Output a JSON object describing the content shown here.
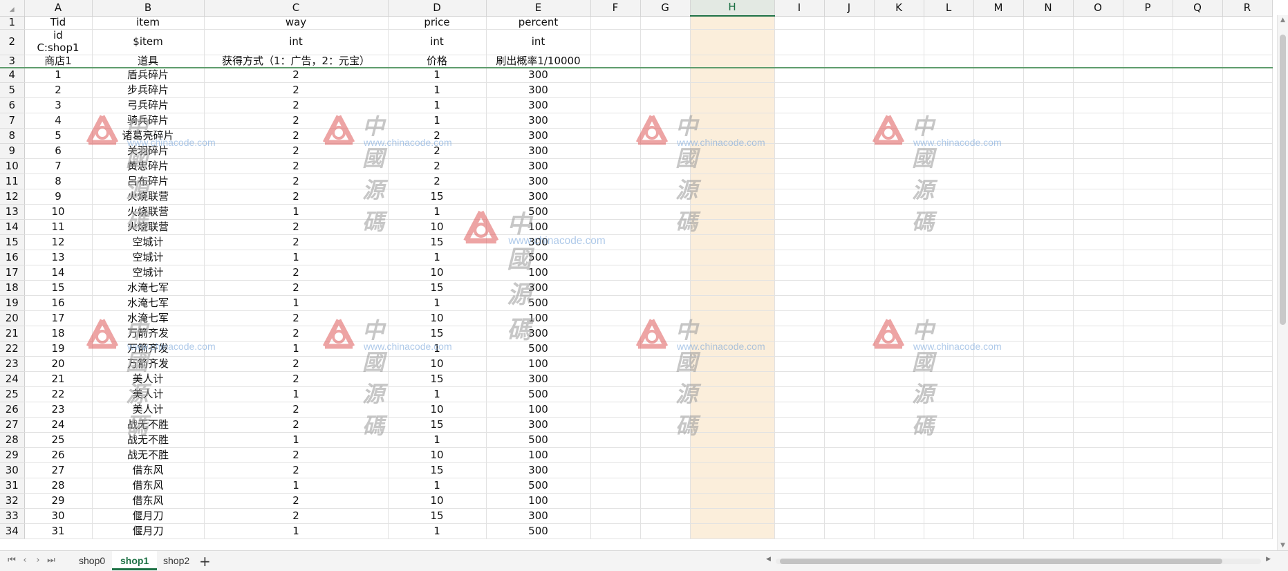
{
  "columns": [
    "A",
    "B",
    "C",
    "D",
    "E",
    "F",
    "G",
    "H",
    "I",
    "J",
    "K",
    "L",
    "M",
    "N",
    "O",
    "P",
    "Q",
    "R"
  ],
  "selected_column": "H",
  "header_rows": [
    {
      "row": "1",
      "cells": [
        "Tid",
        "item",
        "way",
        "price",
        "percent"
      ]
    },
    {
      "row": "2",
      "cells": [
        "id\nC:shop1",
        "$item",
        "int",
        "int",
        "int"
      ]
    },
    {
      "row": "3",
      "cells": [
        "商店1",
        "道具",
        "获得方式（1：广告，2：元宝）",
        "价格",
        "刷出概率1/10000"
      ]
    }
  ],
  "data_rows": [
    {
      "row": "4",
      "cells": [
        "1",
        "盾兵碎片",
        "2",
        "1",
        "300"
      ]
    },
    {
      "row": "5",
      "cells": [
        "2",
        "步兵碎片",
        "2",
        "1",
        "300"
      ]
    },
    {
      "row": "6",
      "cells": [
        "3",
        "弓兵碎片",
        "2",
        "1",
        "300"
      ]
    },
    {
      "row": "7",
      "cells": [
        "4",
        "骑兵碎片",
        "2",
        "1",
        "300"
      ]
    },
    {
      "row": "8",
      "cells": [
        "5",
        "诸葛亮碎片",
        "2",
        "2",
        "300"
      ]
    },
    {
      "row": "9",
      "cells": [
        "6",
        "关羽碎片",
        "2",
        "2",
        "300"
      ]
    },
    {
      "row": "10",
      "cells": [
        "7",
        "黄忠碎片",
        "2",
        "2",
        "300"
      ]
    },
    {
      "row": "11",
      "cells": [
        "8",
        "吕布碎片",
        "2",
        "2",
        "300"
      ]
    },
    {
      "row": "12",
      "cells": [
        "9",
        "火烧联营",
        "2",
        "15",
        "300"
      ]
    },
    {
      "row": "13",
      "cells": [
        "10",
        "火烧联营",
        "1",
        "1",
        "500"
      ]
    },
    {
      "row": "14",
      "cells": [
        "11",
        "火烧联营",
        "2",
        "10",
        "100"
      ]
    },
    {
      "row": "15",
      "cells": [
        "12",
        "空城计",
        "2",
        "15",
        "300"
      ]
    },
    {
      "row": "16",
      "cells": [
        "13",
        "空城计",
        "1",
        "1",
        "500"
      ]
    },
    {
      "row": "17",
      "cells": [
        "14",
        "空城计",
        "2",
        "10",
        "100"
      ]
    },
    {
      "row": "18",
      "cells": [
        "15",
        "水淹七军",
        "2",
        "15",
        "300"
      ]
    },
    {
      "row": "19",
      "cells": [
        "16",
        "水淹七军",
        "1",
        "1",
        "500"
      ]
    },
    {
      "row": "20",
      "cells": [
        "17",
        "水淹七军",
        "2",
        "10",
        "100"
      ]
    },
    {
      "row": "21",
      "cells": [
        "18",
        "万箭齐发",
        "2",
        "15",
        "300"
      ]
    },
    {
      "row": "22",
      "cells": [
        "19",
        "万箭齐发",
        "1",
        "1",
        "500"
      ]
    },
    {
      "row": "23",
      "cells": [
        "20",
        "万箭齐发",
        "2",
        "10",
        "100"
      ]
    },
    {
      "row": "24",
      "cells": [
        "21",
        "美人计",
        "2",
        "15",
        "300"
      ]
    },
    {
      "row": "25",
      "cells": [
        "22",
        "美人计",
        "1",
        "1",
        "500"
      ]
    },
    {
      "row": "26",
      "cells": [
        "23",
        "美人计",
        "2",
        "10",
        "100"
      ]
    },
    {
      "row": "27",
      "cells": [
        "24",
        "战无不胜",
        "2",
        "15",
        "300"
      ]
    },
    {
      "row": "28",
      "cells": [
        "25",
        "战无不胜",
        "1",
        "1",
        "500"
      ]
    },
    {
      "row": "29",
      "cells": [
        "26",
        "战无不胜",
        "2",
        "10",
        "100"
      ]
    },
    {
      "row": "30",
      "cells": [
        "27",
        "借东风",
        "2",
        "15",
        "300"
      ]
    },
    {
      "row": "31",
      "cells": [
        "28",
        "借东风",
        "1",
        "1",
        "500"
      ]
    },
    {
      "row": "32",
      "cells": [
        "29",
        "借东风",
        "2",
        "10",
        "100"
      ]
    },
    {
      "row": "33",
      "cells": [
        "30",
        "偃月刀",
        "2",
        "15",
        "300"
      ]
    },
    {
      "row": "34",
      "cells": [
        "31",
        "偃月刀",
        "1",
        "1",
        "500"
      ]
    }
  ],
  "sheet_tabs": [
    {
      "label": "shop0",
      "active": false
    },
    {
      "label": "shop1",
      "active": true
    },
    {
      "label": "shop2",
      "active": false
    }
  ],
  "add_sheet_label": "+",
  "watermark": {
    "text": "中國源碼",
    "url": "www.chinacode.com"
  },
  "colors": {
    "accent": "#1e7145",
    "highlight_column": "#fbeedb",
    "watermark_logo": "#e05a5a"
  }
}
